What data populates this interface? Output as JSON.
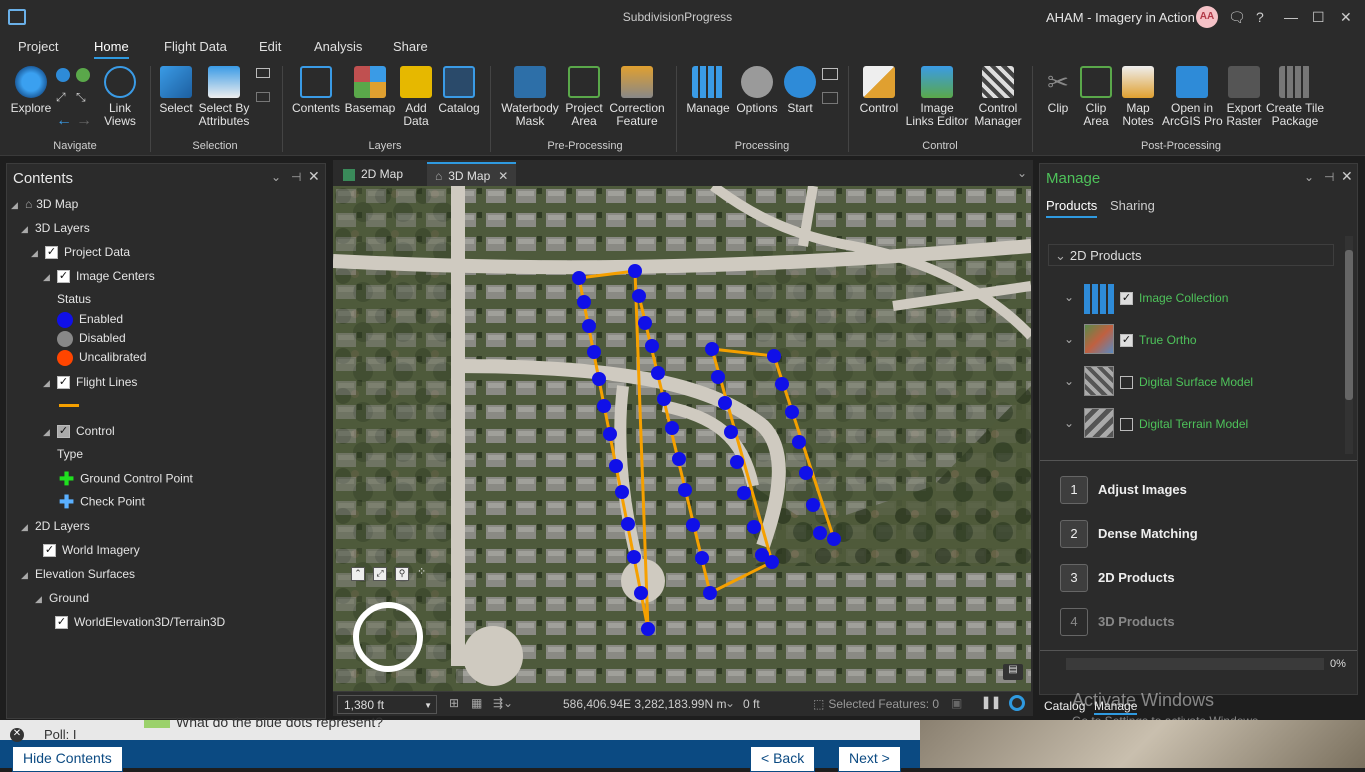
{
  "window": {
    "title": "SubdivisionProgress",
    "user": "AHAM - Imagery in Action",
    "initials": "AA"
  },
  "menu": [
    "Project",
    "Home",
    "Flight Data",
    "Edit",
    "Analysis",
    "Share"
  ],
  "ribbon": {
    "navigate": {
      "label": "Navigate",
      "explore": "Explore",
      "link": "Link\nViews"
    },
    "selection": {
      "label": "Selection",
      "select": "Select",
      "select_by": "Select By\nAttributes"
    },
    "layers": {
      "label": "Layers",
      "contents": "Contents",
      "basemap": "Basemap",
      "add_data": "Add\nData",
      "catalog": "Catalog"
    },
    "preprocessing": {
      "label": "Pre-Processing",
      "waterbody": "Waterbody\nMask",
      "project_area": "Project\nArea",
      "correction": "Correction\nFeature"
    },
    "processing": {
      "label": "Processing",
      "manage": "Manage",
      "options": "Options",
      "start": "Start"
    },
    "control": {
      "label": "Control",
      "control": "Control",
      "image_links": "Image\nLinks Editor",
      "control_manager": "Control\nManager"
    },
    "postprocessing": {
      "label": "Post-Processing",
      "clip": "Clip",
      "clip_area": "Clip\nArea",
      "map_notes": "Map\nNotes",
      "open_pro": "Open in\nArcGIS Pro",
      "export_raster": "Export\nRaster",
      "tile_package": "Create Tile\nPackage"
    }
  },
  "contents": {
    "title": "Contents",
    "map": "3D Map",
    "layers3d": "3D Layers",
    "project_data": "Project Data",
    "image_centers": "Image Centers",
    "status": "Status",
    "enabled": "Enabled",
    "disabled": "Disabled",
    "uncalibrated": "Uncalibrated",
    "flight_lines": "Flight Lines",
    "control": "Control",
    "type": "Type",
    "gcp": "Ground Control Point",
    "check": "Check Point",
    "layers2d": "2D Layers",
    "world_imagery": "World Imagery",
    "elevation": "Elevation Surfaces",
    "ground": "Ground",
    "terrain": "WorldElevation3D/Terrain3D"
  },
  "maptabs": [
    "2D Map",
    "3D Map"
  ],
  "statusbar": {
    "scale": "1,380 ft",
    "coords": "586,406.94E 3,282,183.99N m",
    "elev": "0 ft",
    "selected": "Selected Features: 0"
  },
  "manage": {
    "title": "Manage",
    "tabs": [
      "Products",
      "Sharing"
    ],
    "section": "2D Products",
    "products": [
      "Image Collection",
      "True Ortho",
      "Digital Surface Model",
      "Digital Terrain Model"
    ],
    "steps": [
      {
        "n": "1",
        "label": "Adjust Images"
      },
      {
        "n": "2",
        "label": "Dense Matching"
      },
      {
        "n": "3",
        "label": "2D Products"
      },
      {
        "n": "4",
        "label": "3D Products"
      }
    ],
    "progress": "0%",
    "bottom_tabs": [
      "Catalog",
      "Manage"
    ]
  },
  "watermark": {
    "line1": "Activate Windows",
    "line2": "Go to Settings to activate Windows."
  },
  "course": {
    "poll": "Poll: I",
    "question": "What do the blue dots represent?",
    "hide": "Hide Contents",
    "back": "< Back",
    "next": "Next >"
  },
  "colors": {
    "enabled": "#1010e8",
    "disabled": "#888888",
    "uncalibrated": "#ff4500",
    "flight": "#f5a000",
    "accent": "#4ec25a"
  }
}
